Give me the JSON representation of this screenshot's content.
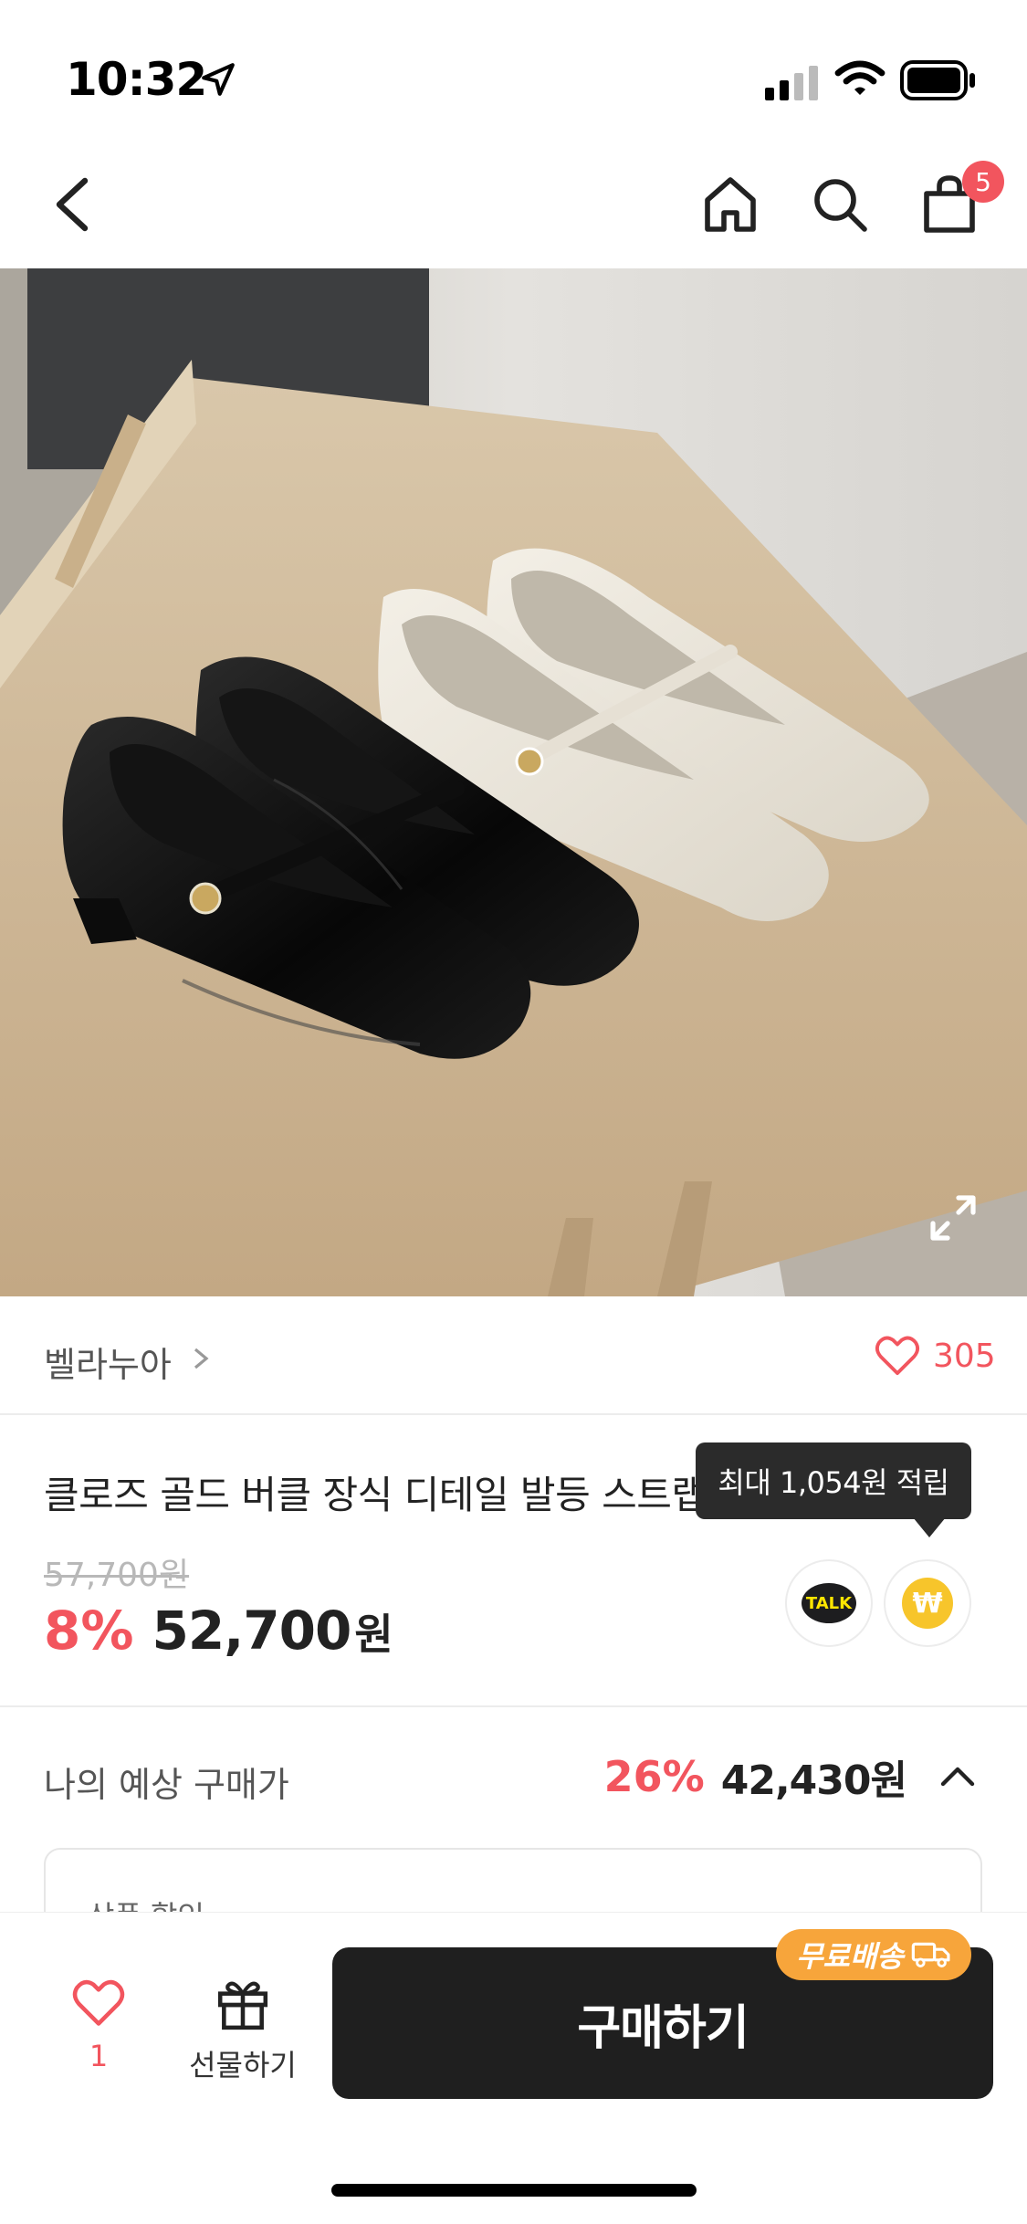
{
  "status_bar": {
    "time": "10:32"
  },
  "nav": {
    "cart_count": "5"
  },
  "product": {
    "brand": "벨라누아",
    "like_count": "305",
    "title": "클로즈 골드 버클 장식 디테일 발등 스트랩 플랫슈즈",
    "original_price": "57,700원",
    "discount_rate": "8%",
    "sale_price": "52,700",
    "currency": "원",
    "points_tooltip": "최대 1,054원 적립",
    "talk_label": "TALK",
    "coin_symbol": "₩"
  },
  "expected": {
    "label": "나의 예상 구매가",
    "discount_rate": "26%",
    "price": "42,430원",
    "box_label": "상품 할인"
  },
  "bottom_bar": {
    "wish_count": "1",
    "gift_label": "선물하기",
    "buy_label": "구매하기",
    "free_shipping": "무료배송"
  },
  "colors": {
    "accent": "#f2555e",
    "buy_button": "#1f1f1f",
    "free_shipping": "#f7a53b"
  }
}
